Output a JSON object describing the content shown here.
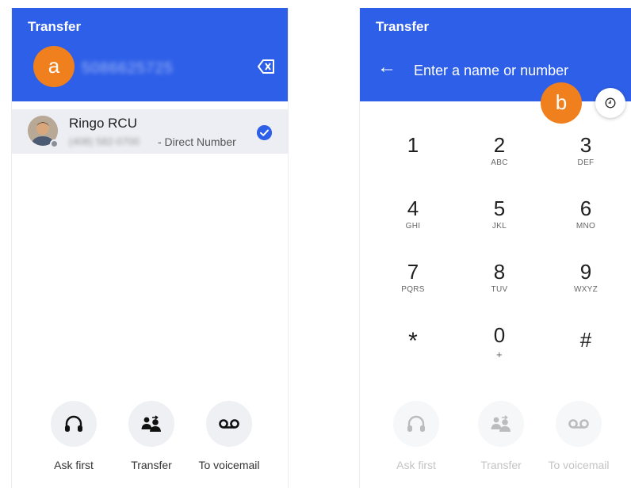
{
  "colors": {
    "header_blue": "#2e5fe8",
    "marker_orange": "#f07f1d",
    "check_blue": "#2e5fe8"
  },
  "markers": {
    "a": "a",
    "b": "b"
  },
  "left": {
    "title": "Transfer",
    "dialed_number": "5086625725",
    "contact": {
      "name": "Ringo RCU",
      "number": "(408) 582-0700",
      "type": "- Direct Number",
      "selected": true
    },
    "actions": [
      {
        "label": "Ask first",
        "icon": "headset-icon"
      },
      {
        "label": "Transfer",
        "icon": "transfer-icon"
      },
      {
        "label": "To voicemail",
        "icon": "voicemail-icon"
      }
    ]
  },
  "right": {
    "title": "Transfer",
    "search_placeholder": "Enter a name or number",
    "keys": [
      {
        "digit": "1",
        "letters": ""
      },
      {
        "digit": "2",
        "letters": "ABC"
      },
      {
        "digit": "3",
        "letters": "DEF"
      },
      {
        "digit": "4",
        "letters": "GHI"
      },
      {
        "digit": "5",
        "letters": "JKL"
      },
      {
        "digit": "6",
        "letters": "MNO"
      },
      {
        "digit": "7",
        "letters": "PQRS"
      },
      {
        "digit": "8",
        "letters": "TUV"
      },
      {
        "digit": "9",
        "letters": "WXYZ"
      },
      {
        "digit": "*",
        "letters": ""
      },
      {
        "digit": "0",
        "letters": "+"
      },
      {
        "digit": "#",
        "letters": ""
      }
    ],
    "actions": [
      {
        "label": "Ask first",
        "icon": "headset-icon",
        "enabled": false
      },
      {
        "label": "Transfer",
        "icon": "transfer-icon",
        "enabled": false
      },
      {
        "label": "To voicemail",
        "icon": "voicemail-icon",
        "enabled": false
      }
    ]
  }
}
